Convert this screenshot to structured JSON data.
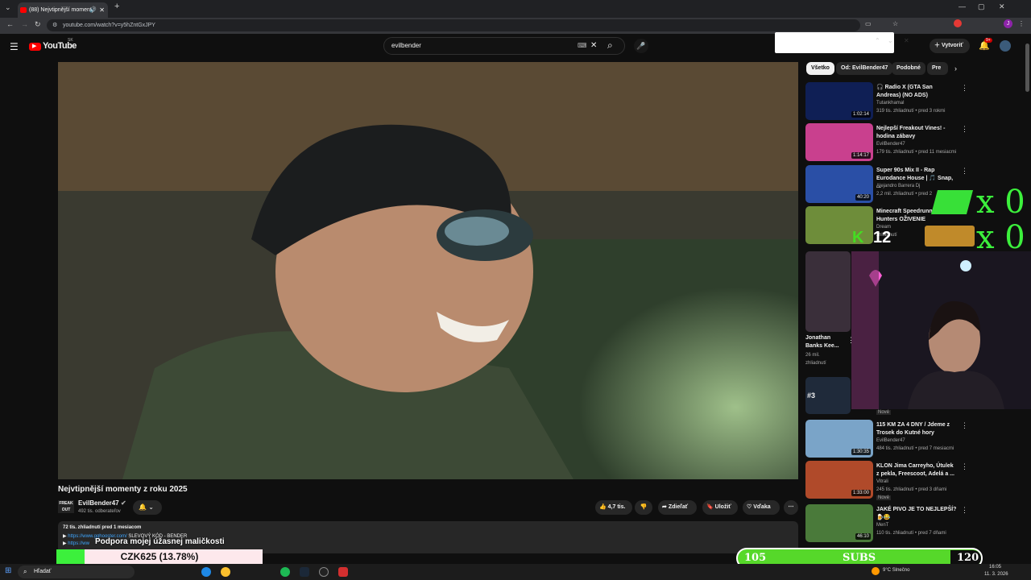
{
  "browser": {
    "tab_title": "(88) Nejvtipnější momenty",
    "url": "youtube.com/watch?v=y5hZntGxJPY"
  },
  "header": {
    "logo_text": "YouTube",
    "logo_country": "SK",
    "search_value": "evilbender",
    "create_label": "Vytvoriť",
    "notif_badge": "9+"
  },
  "video": {
    "title": "Nejvtipnější momenty z roku 2025",
    "channel_name": "EvilBender47",
    "subscribers": "492 tis. odberateľov",
    "likes": "4,7 tis.",
    "share_label": "Zdieľať",
    "save_label": "Uložiť",
    "thanks_label": "Vďaka",
    "stats": "72 tis. zhliadnutí  pred 1 mesiacom",
    "desc_link1": "https://www.gghooster.com/",
    "desc_code": "SLEVOVÝ KÓD - BENDER",
    "desc_link2": "https://ww"
  },
  "chips": [
    "Všetko",
    "Od: EvilBender47",
    "Podobné",
    "Pre v"
  ],
  "sidebar": [
    {
      "title": "🎧 Radio X (GTA San Andreas) (NO ADS)",
      "channel": "Tutankhamal",
      "meta": "319 tis. zhliadnutí • pred 3 rokmi",
      "duration": "1:02:14",
      "thumb": "#3b5fae"
    },
    {
      "title": "Nejlepší Freakout Vines! - hodina zábavy",
      "channel": "EvilBender47",
      "meta": "179 tis. zhliadnutí • pred 11 mesiacmi",
      "duration": "1:14:17",
      "thumb": "#c9408e"
    },
    {
      "title": "Super 90s Mix II - Rap Eurodance House | 🎵 Snap, ...",
      "channel": "Alejandro Barrera Dj",
      "meta": "2,2 mil. zhliadnutí • pred 2",
      "duration": "40:20",
      "thumb": "#2a4fa6"
    },
    {
      "title": "Minecraft Speedrunner VS 5 Hunters OŽIVENIE",
      "channel": "Dream",
      "meta": "zhliadnutí",
      "duration": "",
      "thumb": "#6e8d3a"
    },
    {
      "title": "115 KM ZA 4 DNY / Jdeme z Trosek do Kutné hory",
      "channel": "EvilBender47",
      "meta": "484 tis. zhliadnutí • pred 7 mesiacmi",
      "duration": "1:30:35",
      "thumb": "#7aa4c8"
    },
    {
      "title": "KLON Jima Carreyho, Útulek z pekla, Freescoot, Adelá a ...",
      "channel": "Vitrali",
      "meta": "245 tis. zhliadnutí • pred 3 dňami",
      "badge": "Nové",
      "duration": "1:33:00",
      "thumb": "#b04a2a"
    },
    {
      "title": "JAKÉ PIVO JE TO NEJLEPŠÍ? 🍺😂",
      "channel": "MenT",
      "meta": "110 tis. zhliadnutí • pred 7 dňami",
      "duration": "46:10",
      "thumb": "#4a7a3a"
    }
  ],
  "short": {
    "title": "Jonathan Banks Kee...",
    "views": "26 mil.",
    "views_label": "zhliadnutí",
    "badge": "Nové"
  },
  "overlays": {
    "counter1": "x 0",
    "counter2": "x 0",
    "score": "12",
    "k_letter": "K",
    "support_text": "Podpora mojej úžasnej maličkosti",
    "donation": "CZK625 (13.78%)",
    "subs_current": "105",
    "subs_label": "SUBS",
    "subs_goal": "120",
    "subs_progress": 0.0
  },
  "taskbar": {
    "search_label": "Hľadať",
    "weather": "9°C Slnečno",
    "time": "16:05",
    "date": "11. 3. 2026"
  },
  "colors": {
    "accent": "#ff0000",
    "green": "#3cf03c",
    "lime": "#56d82a"
  }
}
